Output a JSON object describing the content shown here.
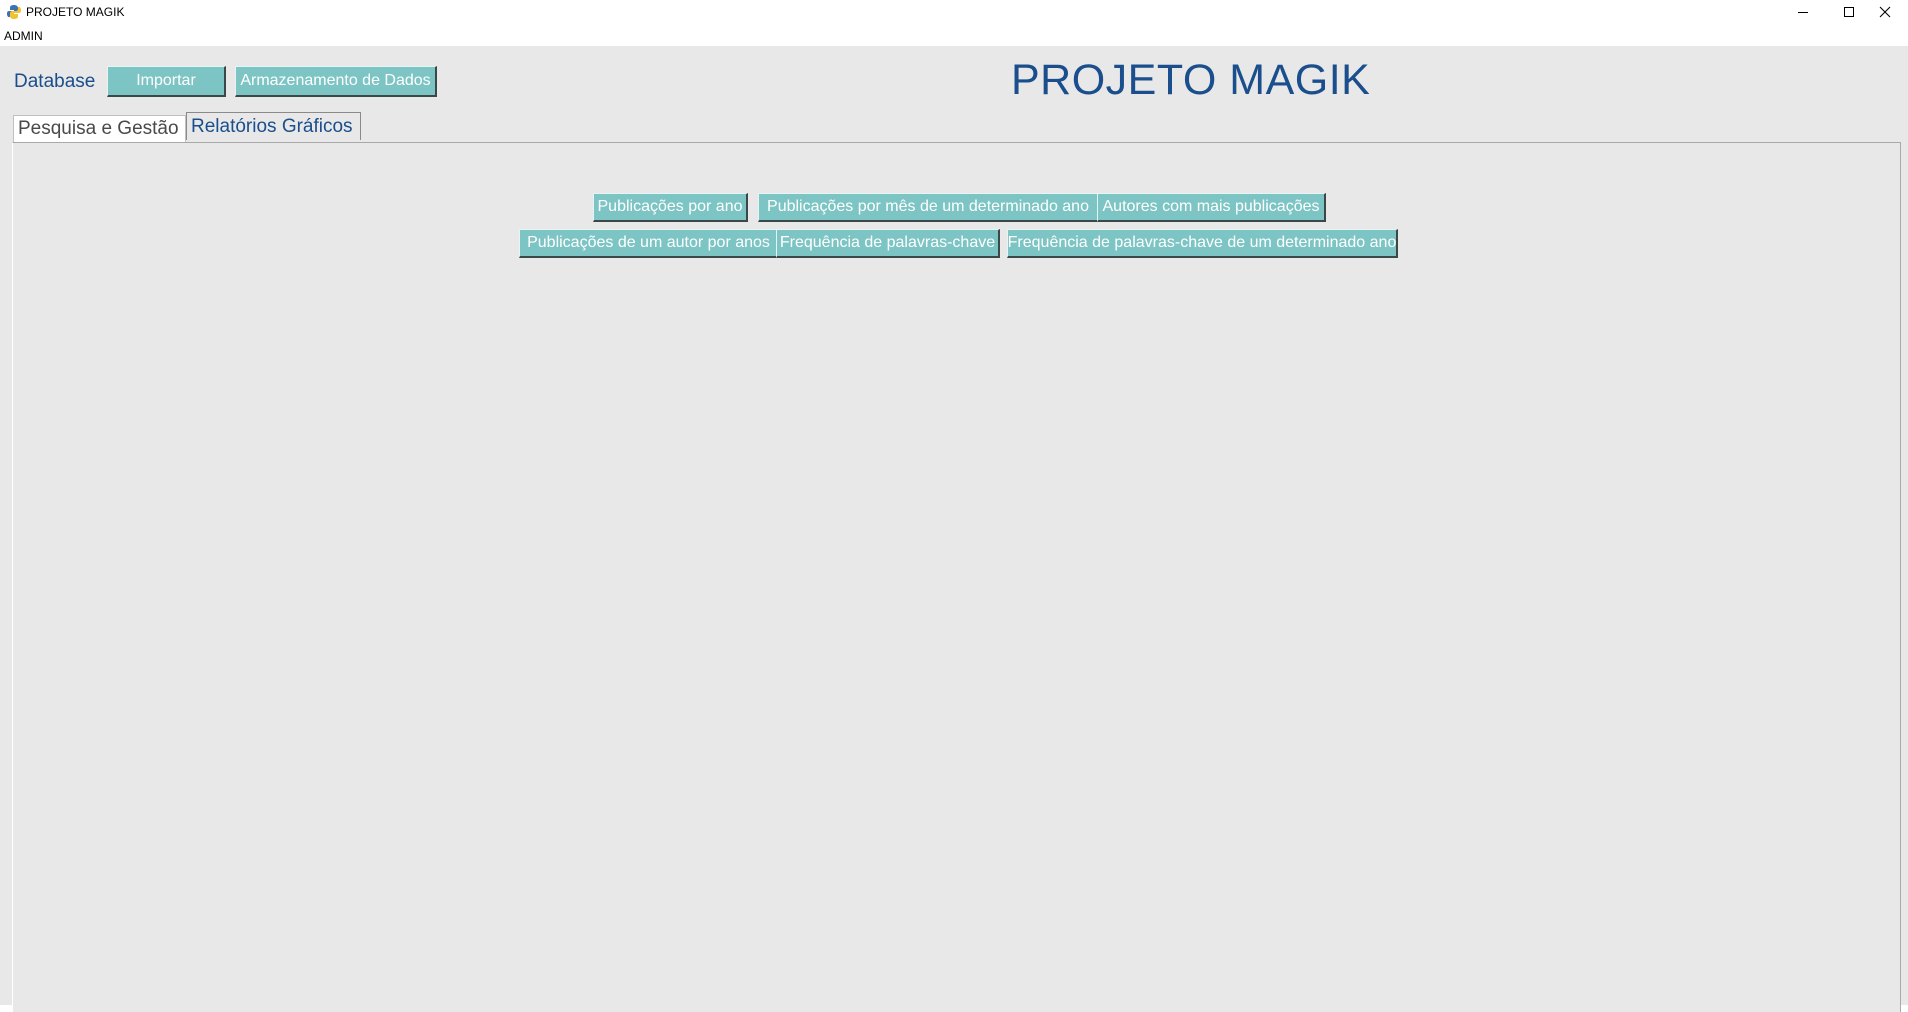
{
  "window": {
    "title": "PROJETO MAGIK",
    "minimize_icon": "minimize-icon",
    "maximize_icon": "maximize-icon",
    "close_icon": "close-icon"
  },
  "menu": {
    "user": "ADMIN"
  },
  "header": {
    "database_label": "Database",
    "import_button": "Importar",
    "storage_button": "Armazenamento de Dados",
    "app_title": "PROJETO MAGIK"
  },
  "tabs": [
    {
      "label": "Pesquisa e Gestão",
      "selected": true
    },
    {
      "label": "Relatórios Gráficos",
      "selected": false
    }
  ],
  "reports": {
    "row1": [
      "Publicações por ano",
      "Publicações por mês de um determinado ano",
      "Autores com mais publicações"
    ],
    "row2": [
      "Publicações de um autor por anos",
      "Frequência de palavras-chave",
      "Frequência de palavras-chave de um determinado ano"
    ]
  },
  "colors": {
    "accent_text": "#1a4e8c",
    "button_bg": "#7dc4c4",
    "client_bg": "#e8e8e8"
  }
}
